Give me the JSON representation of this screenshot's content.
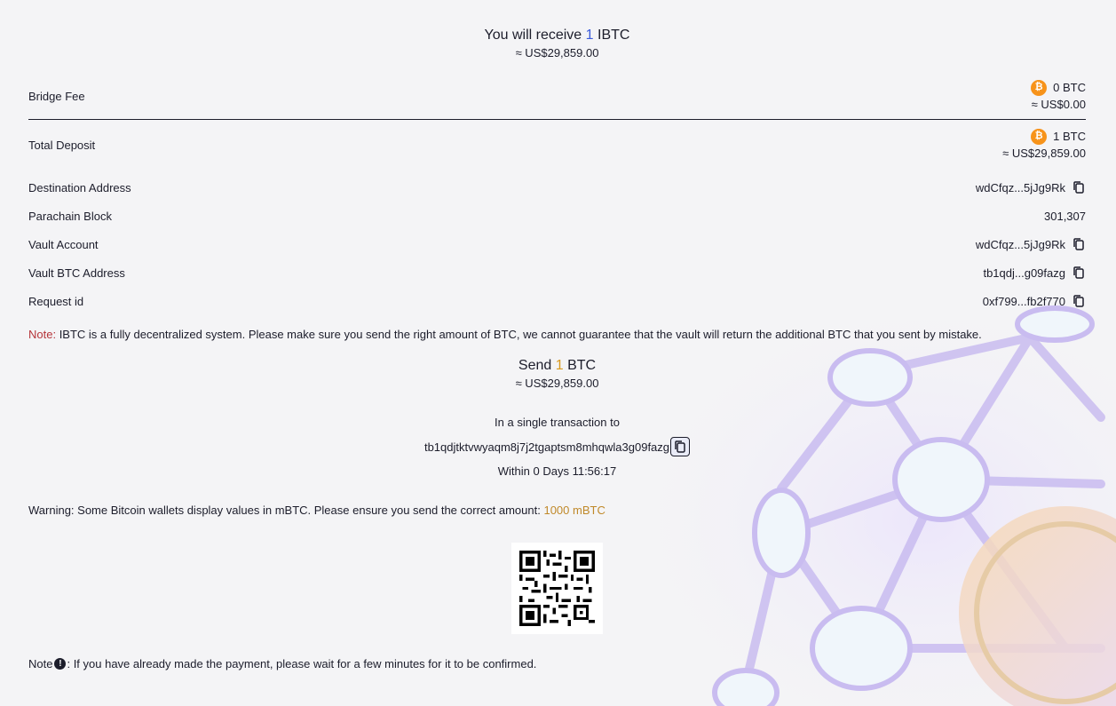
{
  "receive": {
    "prefix": "You will receive",
    "amount": "1",
    "token": "IBTC",
    "usd": "≈ US$29,859.00"
  },
  "rows": {
    "bridge_fee": {
      "label": "Bridge Fee",
      "value": "0 BTC",
      "usd": "≈ US$0.00"
    },
    "total_deposit": {
      "label": "Total Deposit",
      "value": "1 BTC",
      "usd": "≈ US$29,859.00"
    },
    "destination": {
      "label": "Destination Address",
      "value": "wdCfqz...5jJg9Rk"
    },
    "parachain": {
      "label": "Parachain Block",
      "value": "301,307"
    },
    "vault_account": {
      "label": "Vault Account",
      "value": "wdCfqz...5jJg9Rk"
    },
    "vault_btc": {
      "label": "Vault BTC Address",
      "value": "tb1qdj...g09fazg"
    },
    "request_id": {
      "label": "Request id",
      "value": "0xf799...fb2f770"
    }
  },
  "note": {
    "tag": "Note:",
    "text": " IBTC is a fully decentralized system. Please make sure you send the right amount of BTC, we cannot guarantee that the vault will return the additional BTC that you sent by mistake."
  },
  "send": {
    "prefix": "Send",
    "amount": "1",
    "token": "BTC",
    "usd": "≈ US$29,859.00"
  },
  "transaction": {
    "label": "In a single transaction to",
    "address": "tb1qdjtktvwyaqm8j7j2tgaptsm8mhqwla3g09fazg",
    "within": "Within 0 Days 11:56:17"
  },
  "warning": {
    "text": "Warning: Some Bitcoin wallets display values in mBTC. Please ensure you send the correct amount: ",
    "amount": "1000 mBTC"
  },
  "footer_note": {
    "label": "Note",
    "text": ": If you have already made the payment, please wait for a few minutes for it to be confirmed."
  },
  "icons": {
    "btc": "bitcoin-icon",
    "copy": "copy-icon",
    "info": "info-icon"
  },
  "colors": {
    "receive_amount": "#3b5bdb",
    "send_amount": "#d99a1f",
    "note_tag": "#b5343a",
    "btc": "#f7931a"
  }
}
